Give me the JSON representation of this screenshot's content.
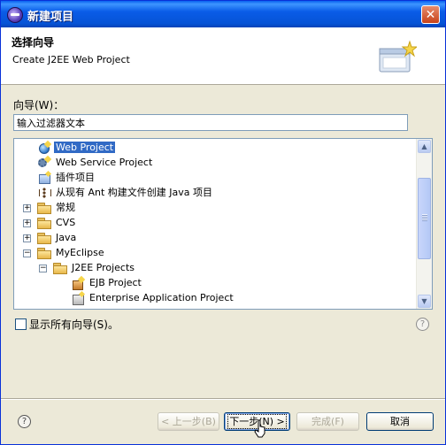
{
  "window": {
    "title": "新建项目"
  },
  "header": {
    "title": "选择向导",
    "description": "Create J2EE Web Project",
    "banner_icon": "new-project-wizard-banner-icon"
  },
  "filter": {
    "label": "向导(W)：",
    "placeholder": "输入过滤器文本",
    "value": "输入过滤器文本"
  },
  "tree": {
    "items": [
      {
        "label": "Web Project",
        "icon": "web-project-icon",
        "selected": true
      },
      {
        "label": "Web Service Project",
        "icon": "web-service-icon"
      },
      {
        "label": "插件项目",
        "icon": "plugin-project-icon"
      },
      {
        "label": "从现有 Ant 构建文件创建 Java 项目",
        "icon": "ant-icon"
      },
      {
        "label": "常规",
        "icon": "folder-icon",
        "expanded": false
      },
      {
        "label": "CVS",
        "icon": "folder-icon",
        "expanded": false
      },
      {
        "label": "Java",
        "icon": "folder-icon",
        "expanded": false
      },
      {
        "label": "MyEclipse",
        "icon": "folder-icon",
        "expanded": true
      },
      {
        "label": "J2EE Projects",
        "icon": "folder-icon",
        "expanded": true
      },
      {
        "label": "EJB Project",
        "icon": "ejb-project-icon"
      },
      {
        "label": "Enterprise Application Project",
        "icon": "enterprise-app-icon"
      }
    ]
  },
  "show_all": {
    "label": "显示所有向导(S)。",
    "checked": false
  },
  "buttons": {
    "back": "< 上一步(B)",
    "next": "下一步(N) >",
    "finish": "完成(F)",
    "cancel": "取消"
  },
  "colors": {
    "title_bar": "#0a5ce8",
    "selection": "#316ac5",
    "dialog_bg": "#ece9d8"
  }
}
